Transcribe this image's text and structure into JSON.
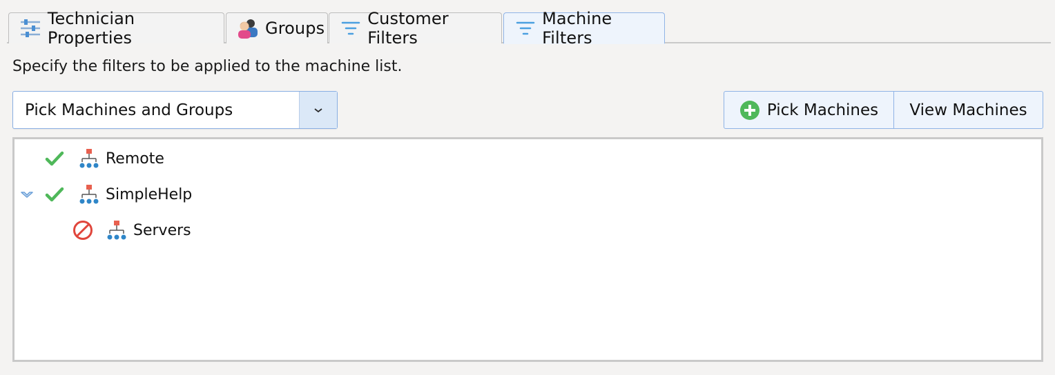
{
  "tabs": [
    {
      "label": "Technician Properties",
      "icon": "sliders-icon",
      "active": false
    },
    {
      "label": "Groups",
      "icon": "users-icon",
      "active": false
    },
    {
      "label": "Customer Filters",
      "icon": "filter-icon",
      "active": false
    },
    {
      "label": "Machine Filters",
      "icon": "filter-icon",
      "active": true
    }
  ],
  "description": "Specify the filters to be applied to the machine list.",
  "filter_mode": {
    "selected": "Pick Machines and Groups"
  },
  "buttons": {
    "pick_machines": "Pick Machines",
    "view_machines": "View Machines"
  },
  "tree": [
    {
      "label": "Remote",
      "status": "allowed",
      "expanded": false,
      "level": 0
    },
    {
      "label": "SimpleHelp",
      "status": "allowed",
      "expanded": true,
      "level": 0
    },
    {
      "label": "Servers",
      "status": "denied",
      "expanded": false,
      "level": 1
    }
  ],
  "colors": {
    "accent": "#8fb3e6",
    "check": "#4fb85a",
    "deny": "#e0463c",
    "group_top": "#e8604f",
    "group_nodes": "#2f86c8"
  }
}
